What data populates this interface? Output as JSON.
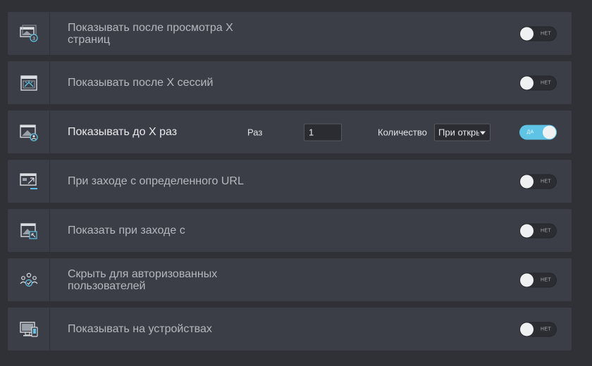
{
  "rows": [
    {
      "label": "Показывать после просмотра X страниц",
      "toggle": "НЕТ",
      "icon": "pages-icon"
    },
    {
      "label": "Показывать после X сессий",
      "toggle": "НЕТ",
      "icon": "sessions-icon"
    },
    {
      "label": "Показывать до X раз",
      "toggle": "ДА",
      "icon": "user-window-icon",
      "times_label": "Раз",
      "times_value": "1",
      "quantity_label": "Количество",
      "quantity_value": "При откры"
    },
    {
      "label": "При заходе с определенного URL",
      "toggle": "НЕТ",
      "icon": "url-icon"
    },
    {
      "label": "Показать при заходе с",
      "toggle": "НЕТ",
      "icon": "referrer-icon"
    },
    {
      "label": "Скрыть для авторизованных пользователей",
      "toggle": "НЕТ",
      "icon": "users-icon"
    },
    {
      "label": "Показывать на устройствах",
      "toggle": "НЕТ",
      "icon": "devices-icon"
    }
  ],
  "colors": {
    "accent": "#5ec3e4",
    "row_bg": "#3b3e46",
    "page_bg": "#2f3136"
  }
}
